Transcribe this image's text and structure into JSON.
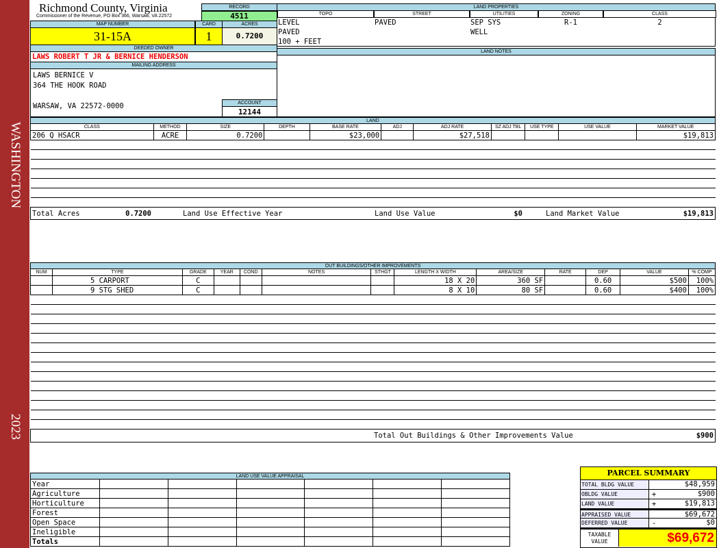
{
  "sidebar": {
    "county_name": "WASHINGTON",
    "year": "2023",
    "color": "#a62b2b"
  },
  "header": {
    "title": "Richmond County, Virginia",
    "subtitle": "Commissioner of the Revenue, PO Box 366, Warsaw, VA 22572"
  },
  "record": {
    "label": "RECORD",
    "value": "4511"
  },
  "map_number": {
    "label": "MAP NUMBER",
    "value": "31-15A"
  },
  "card": {
    "label": "CARD",
    "value": "1"
  },
  "acres": {
    "label": "ACRES",
    "value": "0.7200"
  },
  "owner": {
    "label": "DEEDED OWNER",
    "value": "LAWS ROBERT T JR & BERNICE HENDERSON"
  },
  "mailing": {
    "label": "MAILING ADDRESS",
    "line1": "LAWS BERNICE V",
    "line2": "364 THE HOOK ROAD",
    "line3": "WARSAW, VA 22572-0000"
  },
  "account": {
    "label": "ACCOUNT",
    "value": "12144"
  },
  "land_properties": {
    "label": "LAND PROPERTIES",
    "columns": [
      "TOPO",
      "STREET",
      "UTILITIES",
      "ZONING",
      "CLASS"
    ],
    "topo": [
      "LEVEL",
      "PAVED",
      "100 + FEET"
    ],
    "street": [
      "PAVED"
    ],
    "utilities": [
      "SEP SYS",
      "WELL"
    ],
    "zoning": [
      "R-1"
    ],
    "class": [
      "2"
    ]
  },
  "land_notes": {
    "label": "LAND NOTES"
  },
  "land": {
    "label": "LAND",
    "columns": [
      "CLASS",
      "METHOD",
      "SIZE",
      "DEPTH",
      "BASE RATE",
      "ADJ",
      "ADJ RATE",
      "SZ ADJ TBL",
      "USE TYPE",
      "USE VALUE",
      "MARKET VALUE"
    ],
    "rows": [
      [
        "206 Q HSACR",
        "ACRE",
        "0.7200",
        "",
        "$23,000",
        "",
        "$27,518",
        "",
        "",
        "",
        "$19,813"
      ]
    ],
    "totals": {
      "acres_label": "Total Acres",
      "acres": "0.7200",
      "effective_year_label": "Land Use Effective Year",
      "effective_year": "",
      "use_value_label": "Land Use Value",
      "use_value": "$0",
      "market_value_label": "Land Market Value",
      "market_value": "$19,813"
    }
  },
  "outbuildings": {
    "label": "OUT BUILDINGS/OTHER IMPROVEMENTS",
    "columns": [
      "NUM",
      "TYPE",
      "GRADE",
      "YEAR",
      "COND",
      "NOTES",
      "STHGT",
      "LENGTH X WIDTH",
      "AREA/SIZE",
      "RATE",
      "DEP",
      "VALUE",
      "% COMP"
    ],
    "rows": [
      [
        "",
        "5 CARPORT",
        "C",
        "",
        "",
        "",
        "",
        "18 X 20",
        "360 SF",
        "",
        "0.60",
        "$500",
        "100%"
      ],
      [
        "",
        "9 STG SHED",
        "C",
        "",
        "",
        "",
        "",
        "8 X 10",
        "80 SF",
        "",
        "0.60",
        "$400",
        "100%"
      ]
    ],
    "total_label": "Total Out Buildings & Other Improvements Value",
    "total": "$900"
  },
  "land_use_appraisal": {
    "label": "LAND USE VALUE APPRAISAL",
    "rows": [
      "Year",
      "Agriculture",
      "Horticulture",
      "Forest",
      "Open Space",
      "Ineligible",
      "Totals"
    ]
  },
  "parcel_summary": {
    "title": "PARCEL SUMMARY",
    "rows": [
      {
        "label": "TOTAL BLDG VALUE",
        "sign": "",
        "value": "$48,959"
      },
      {
        "label": "OBLDG VALUE",
        "sign": "+",
        "value": "$900"
      },
      {
        "label": "LAND VALUE",
        "sign": "+",
        "value": "$19,813"
      },
      {
        "label": "APPRAISED VALUE",
        "sign": "",
        "value": "$69,672"
      },
      {
        "label": "DEFERRED VALUE",
        "sign": "-",
        "value": "$0"
      }
    ],
    "taxable_label": "TAXABLE VALUE",
    "taxable_value": "$69,672"
  }
}
